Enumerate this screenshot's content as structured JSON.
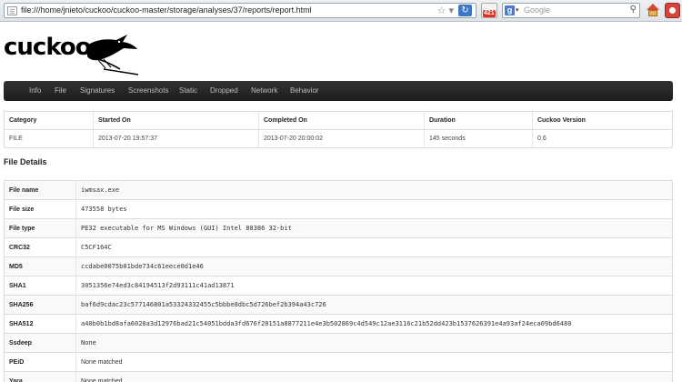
{
  "browser": {
    "url": "file:///home/jnieto/cuckoo/cuckoo-master/storage/analyses/37/reports/report.html",
    "badge_count": "421",
    "search_placeholder": "Google"
  },
  "header": {
    "logo_text": "cuckoo"
  },
  "nav": {
    "items": [
      "Info",
      "File",
      "Signatures",
      "Screenshots",
      "Static",
      "Dropped",
      "Network",
      "Behavior"
    ]
  },
  "info_table": {
    "headers": [
      "Category",
      "Started On",
      "Completed On",
      "Duration",
      "Cuckoo Version"
    ],
    "row": [
      "FILE",
      "2013-07-20 19:57:37",
      "2013-07-20 20:00:02",
      "145 seconds",
      "0.6"
    ]
  },
  "file_details": {
    "title": "File Details",
    "rows": [
      {
        "key": "File name",
        "value": "iwmsax.exe"
      },
      {
        "key": "File size",
        "value": "473558 bytes"
      },
      {
        "key": "File type",
        "value": "PE32 executable for MS Windows (GUI) Intel 80386 32-bit"
      },
      {
        "key": "CRC32",
        "value": "C5CF164C"
      },
      {
        "key": "MD5",
        "value": "ccdabe0075b01bde734c61eece0d1e46"
      },
      {
        "key": "SHA1",
        "value": "3051356e74ed3c84194513f2d93111c41ad13871"
      },
      {
        "key": "SHA256",
        "value": "baf6d9cdac23c577146801a53324332455c5bbbe8dbc5d726bef2b394a43c726"
      },
      {
        "key": "SHA512",
        "value": "a40b0b1bd8afa6020a3d12976bad21c54051bdda3fd676f20151a8877211e4e3b502869c4d549c12ae3116c21b52dd423b1537626391e4a93af24eca09bd6480"
      },
      {
        "key": "Ssdeep",
        "value": "None"
      },
      {
        "key": "PEiD",
        "value": "None matched"
      },
      {
        "key": "Yara",
        "value": "None matched"
      }
    ]
  }
}
